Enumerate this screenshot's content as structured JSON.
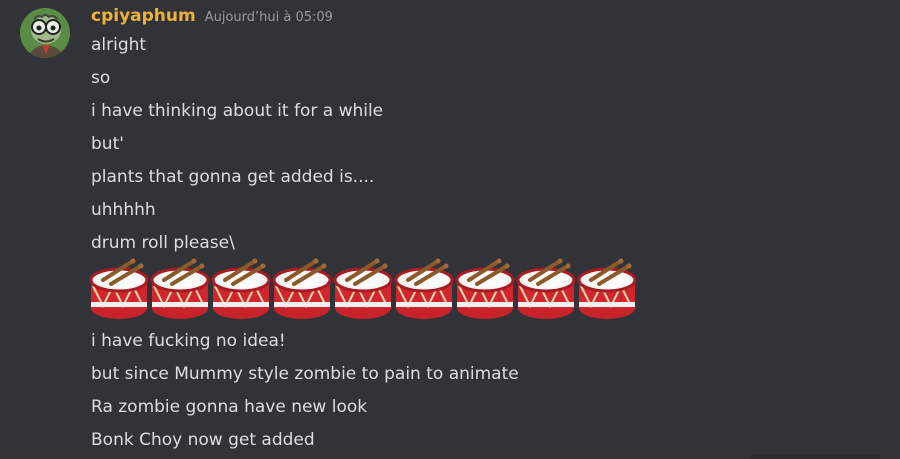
{
  "message": {
    "username": "cpiyaphum",
    "timestamp": "Aujourd’hui à 05:09",
    "avatar_icon": "zombie-avatar-icon",
    "lines_before": [
      "alright",
      "so",
      "i have thinking about it for a while",
      "but'",
      "plants that gonna get added is....",
      "uhhhhh",
      "drum roll please\\"
    ],
    "drum_emoji": "🥁",
    "drum_count": 9,
    "lines_after": [
      "i have fucking no idea!",
      "but since Mummy style zombie to pain to animate",
      "Ra zombie gonna have new look",
      "Bonk Choy now get added"
    ]
  },
  "colors": {
    "background": "#313338",
    "username": "#f0b232",
    "text": "#dbdee1",
    "timestamp": "#949ba4"
  }
}
